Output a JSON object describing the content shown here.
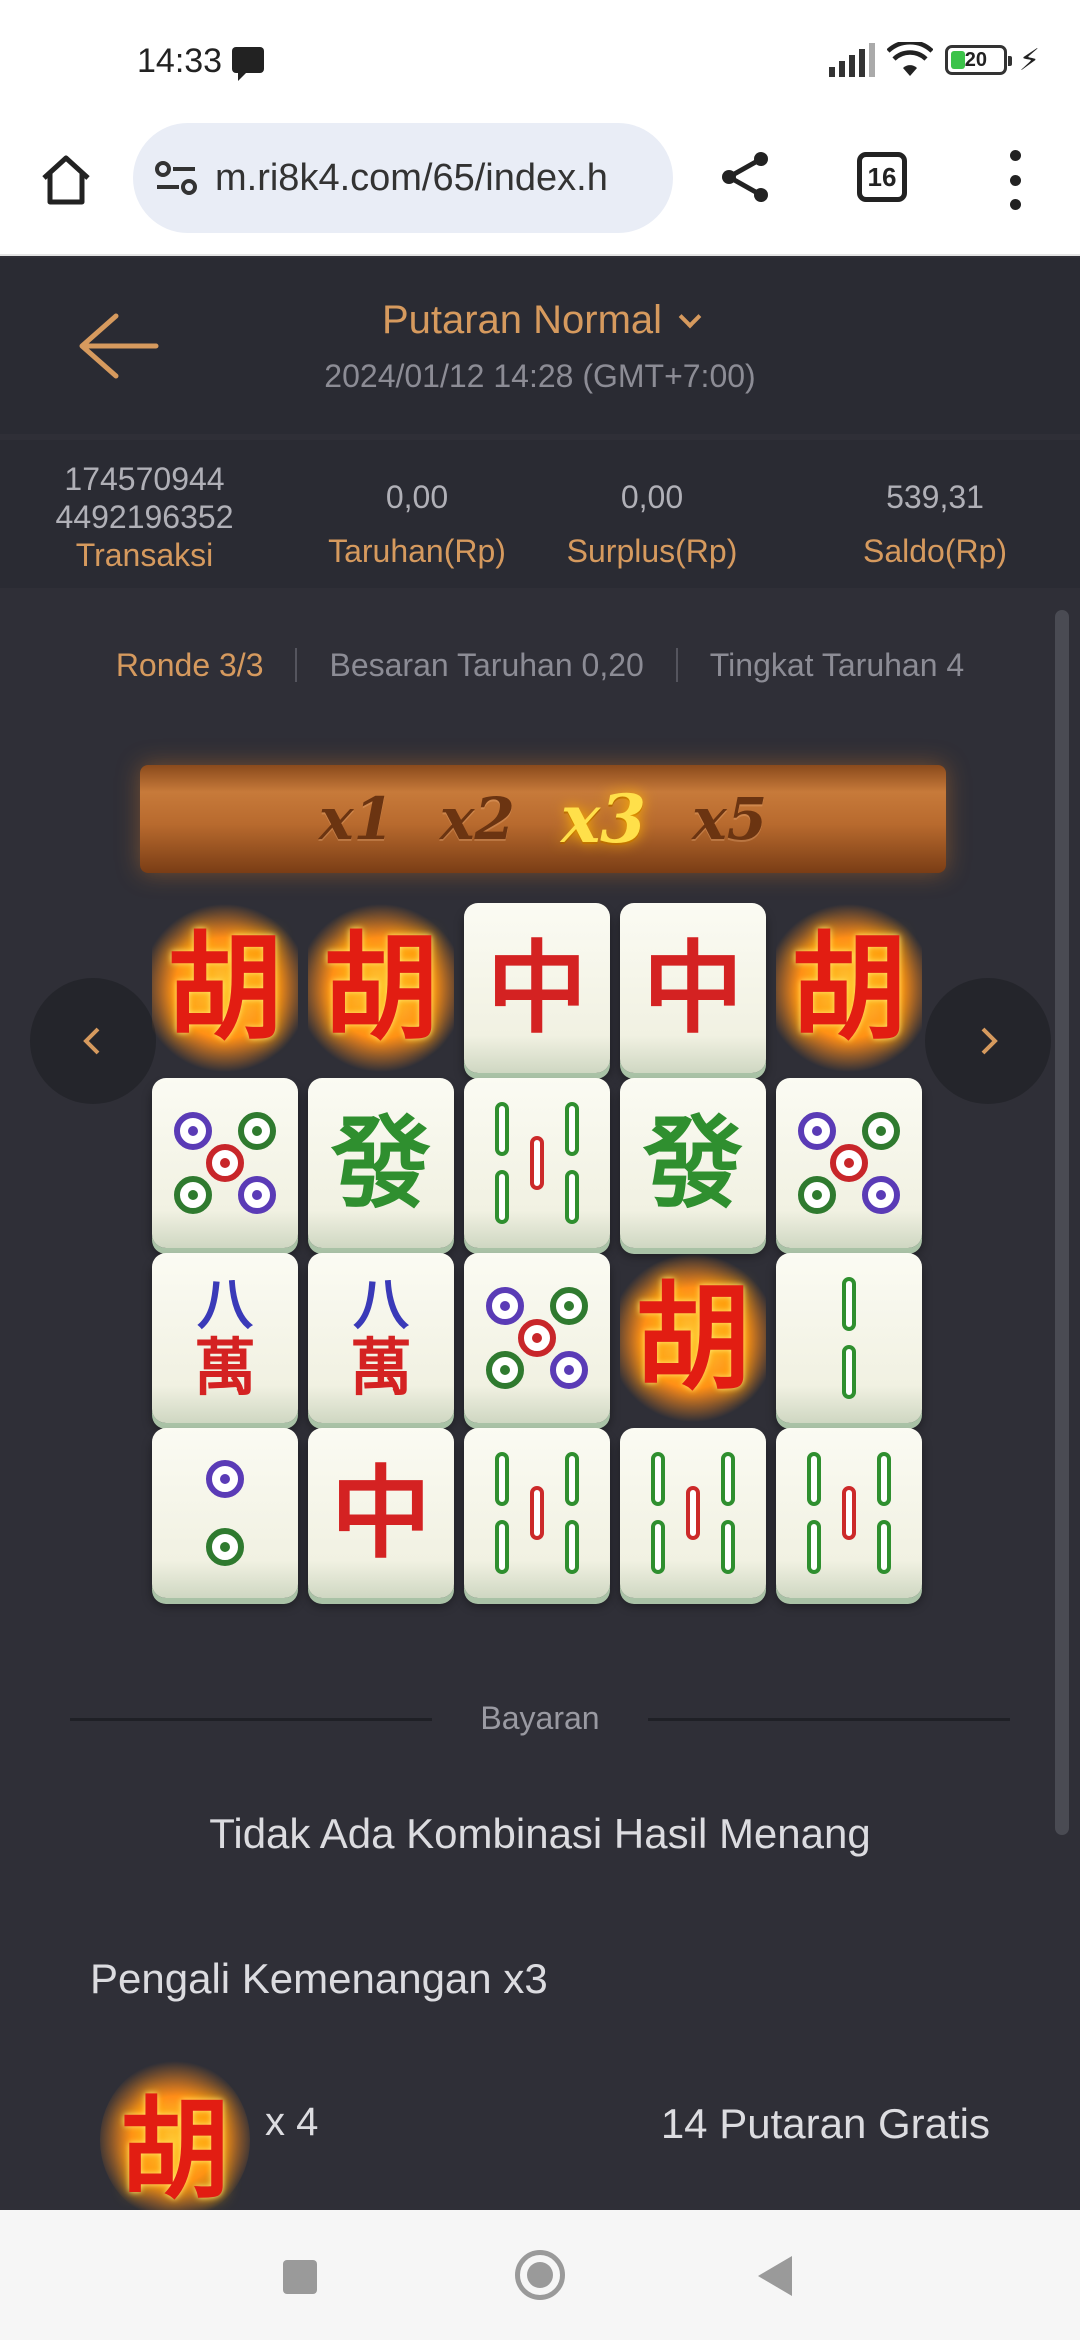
{
  "status_bar": {
    "time": "14:33",
    "battery": "20"
  },
  "browser": {
    "url": "m.ri8k4.com/65/index.h",
    "tab_count": "16"
  },
  "header": {
    "title": "Putaran Normal",
    "datetime": "2024/01/12 14:28 (GMT+7:00)"
  },
  "stats": {
    "transaction_id_line1": "174570944",
    "transaction_id_line2": "4492196352",
    "transaction_label": "Transaksi",
    "bet_value": "0,00",
    "bet_label": "Taruhan(Rp)",
    "surplus_value": "0,00",
    "surplus_label": "Surplus(Rp)",
    "balance_value": "539,31",
    "balance_label": "Saldo(Rp)"
  },
  "round_info": {
    "round": "Ronde 3/3",
    "bet_size": "Besaran Taruhan 0,20",
    "bet_level": "Tingkat Taruhan 4"
  },
  "multipliers": {
    "items": [
      "x1",
      "x2",
      "x3",
      "x5"
    ],
    "active": "x3"
  },
  "tile_glyphs": {
    "wild": "胡",
    "red_dragon": "中",
    "green_dragon": "發",
    "eight_top": "八",
    "wan_bottom": "萬"
  },
  "payout": {
    "section_label": "Bayaran",
    "result": "Tidak Ada Kombinasi Hasil Menang",
    "multiplier_text": "Pengali Kemenangan x3",
    "scatter_glyph": "胡",
    "scatter_count": "x 4",
    "free_spins": "14 Putaran Gratis"
  }
}
